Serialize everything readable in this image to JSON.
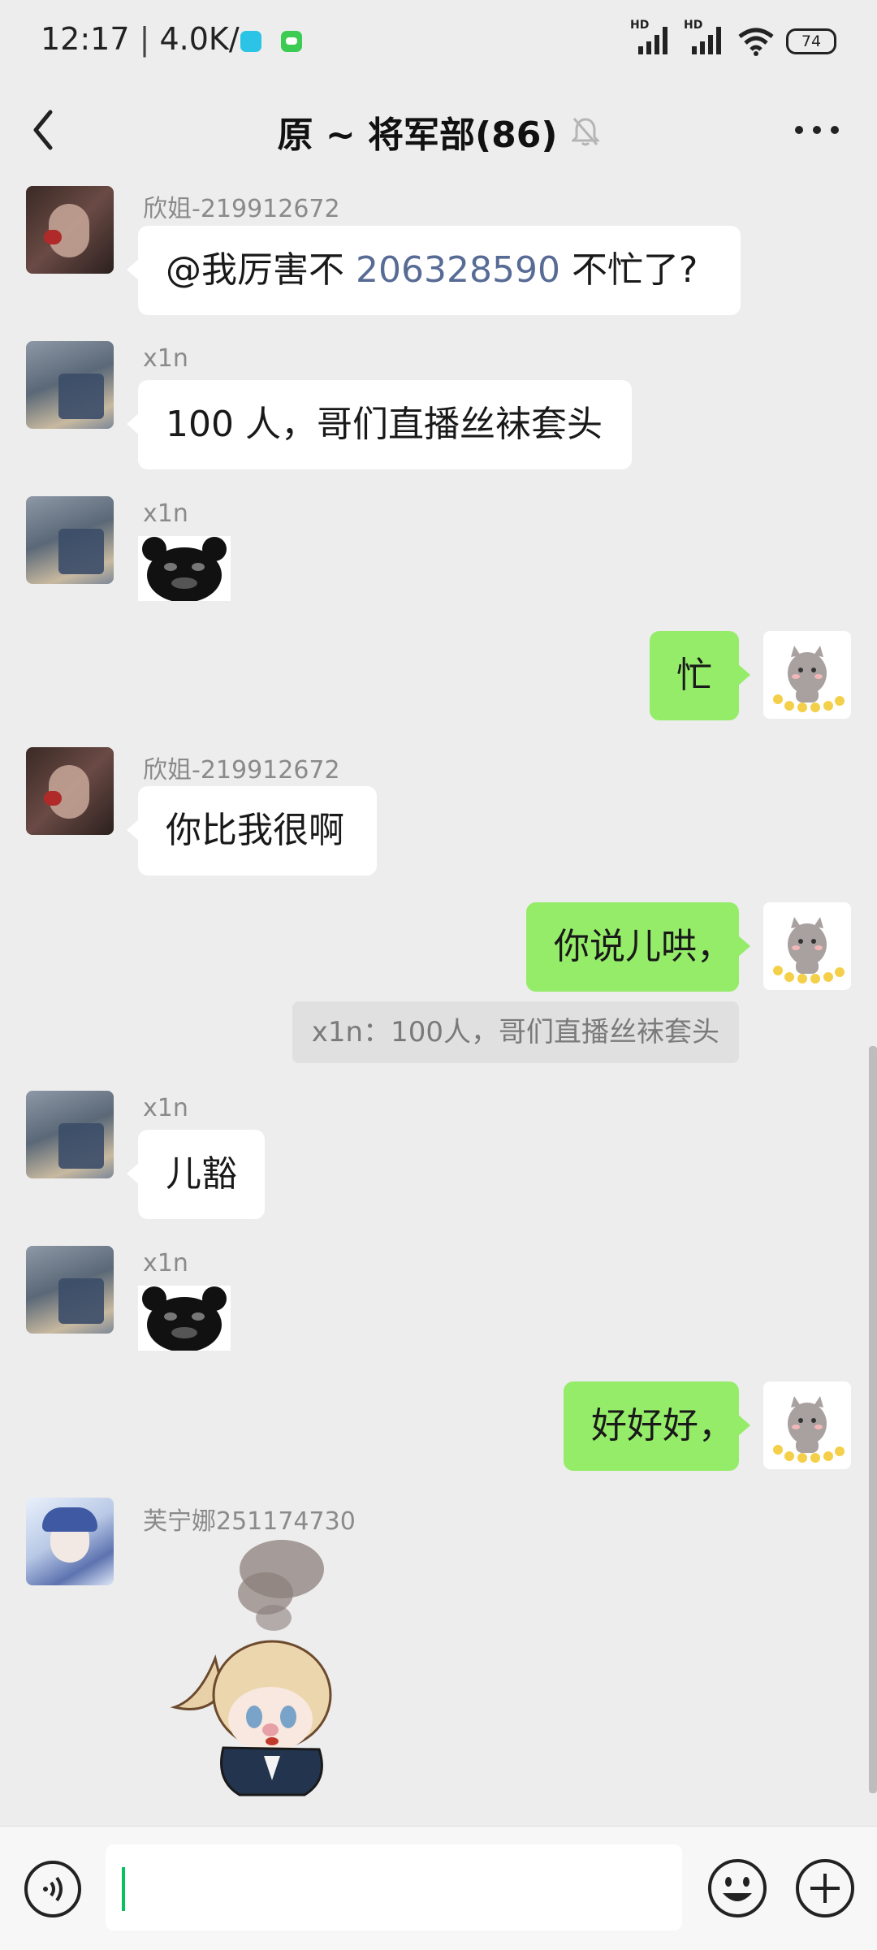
{
  "status_bar": {
    "time": "12:17",
    "net_speed": "4.0K/s",
    "signal_1_label": "HD",
    "signal_2_label": "HD",
    "battery": "74"
  },
  "header": {
    "title": "原 ~ 将军部(86)",
    "back_icon": "chevron-left-icon",
    "mute_icon": "bell-off-icon",
    "more_icon": "more-dots-icon"
  },
  "messages": [
    {
      "sender": "欣姐-219912672",
      "text_prefix": "@我厉害不 ",
      "mention": "206328590",
      "text_suffix": " 不忙了?"
    },
    {
      "sender": "x1n",
      "text": "100 人，哥们直播丝袜套头"
    },
    {
      "sender": "x1n",
      "sticker": "black-bear-sticker"
    },
    {
      "self": true,
      "text": "忙"
    },
    {
      "sender": "欣姐-219912672",
      "text": "你比我很啊"
    },
    {
      "self": true,
      "text": "你说儿哄，",
      "quote": "x1n：100人，哥们直播丝袜套头"
    },
    {
      "sender": "x1n",
      "text": "儿豁"
    },
    {
      "sender": "x1n",
      "sticker": "black-bear-sticker"
    },
    {
      "self": true,
      "text": "好好好，"
    },
    {
      "sender": "芙宁娜251174730",
      "sticker": "anime-girl-steam-sticker"
    }
  ],
  "input_bar": {
    "voice_icon": "voice-icon",
    "emoji_icon": "emoji-icon",
    "plus_icon": "plus-icon",
    "value": ""
  },
  "colors": {
    "background": "#ededed",
    "self_bubble": "#95ec69",
    "other_bubble": "#ffffff",
    "mention": "#576b95",
    "caret": "#07c160"
  }
}
